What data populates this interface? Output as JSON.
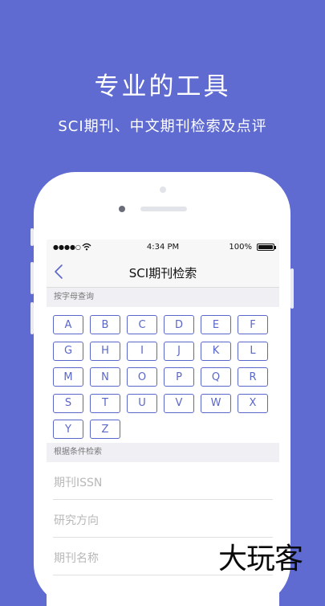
{
  "hero": {
    "title": "专业的工具",
    "subtitle": "SCI期刊、中文期刊检索及点评"
  },
  "status_bar": {
    "signal": "●●●●○",
    "time": "4:34 PM",
    "battery": "100%"
  },
  "nav": {
    "title": "SCI期刊检索"
  },
  "letter_section": {
    "header": "按字母查询",
    "letters": [
      "A",
      "B",
      "C",
      "D",
      "E",
      "F",
      "G",
      "H",
      "I",
      "J",
      "K",
      "L",
      "M",
      "N",
      "O",
      "P",
      "Q",
      "R",
      "S",
      "T",
      "U",
      "V",
      "W",
      "X",
      "Y",
      "Z"
    ]
  },
  "condition_section": {
    "header": "根据条件检索",
    "fields": [
      {
        "placeholder": "期刊ISSN"
      },
      {
        "placeholder": "研究方向"
      },
      {
        "placeholder": "期刊名称"
      }
    ]
  },
  "watermark": "大玩客",
  "colors": {
    "background": "#5f6bd0",
    "accent": "#5a66c9"
  }
}
